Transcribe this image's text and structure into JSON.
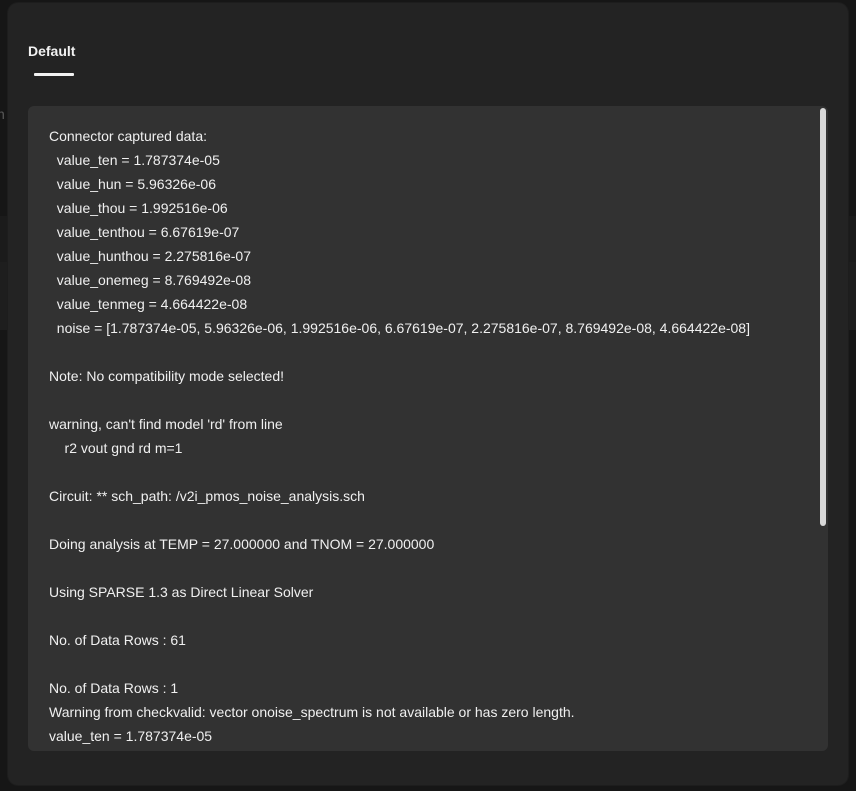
{
  "background": {
    "partial_text": "n"
  },
  "modal": {
    "tabs": [
      {
        "label": "Default",
        "active": true
      }
    ]
  },
  "log": {
    "lines": [
      "Connector captured data:",
      "  value_ten = 1.787374e-05",
      "  value_hun = 5.96326e-06",
      "  value_thou = 1.992516e-06",
      "  value_tenthou = 6.67619e-07",
      "  value_hunthou = 2.275816e-07",
      "  value_onemeg = 8.769492e-08",
      "  value_tenmeg = 4.664422e-08",
      "  noise = [1.787374e-05, 5.96326e-06, 1.992516e-06, 6.67619e-07, 2.275816e-07, 8.769492e-08, 4.664422e-08]",
      "",
      "Note: No compatibility mode selected!",
      "",
      "warning, can't find model 'rd' from line",
      "    r2 vout gnd rd m=1",
      "",
      "Circuit: ** sch_path: /v2i_pmos_noise_analysis.sch",
      "",
      "Doing analysis at TEMP = 27.000000 and TNOM = 27.000000",
      "",
      "Using SPARSE 1.3 as Direct Linear Solver",
      "",
      "No. of Data Rows : 61",
      "",
      "No. of Data Rows : 1",
      "Warning from checkvalid: vector onoise_spectrum is not available or has zero length.",
      "value_ten = 1.787374e-05"
    ]
  },
  "colors": {
    "modal_bg": "#232323",
    "log_bg": "#323232",
    "text": "#f0f0f0",
    "scrollbar_thumb": "#d8d8d8"
  }
}
